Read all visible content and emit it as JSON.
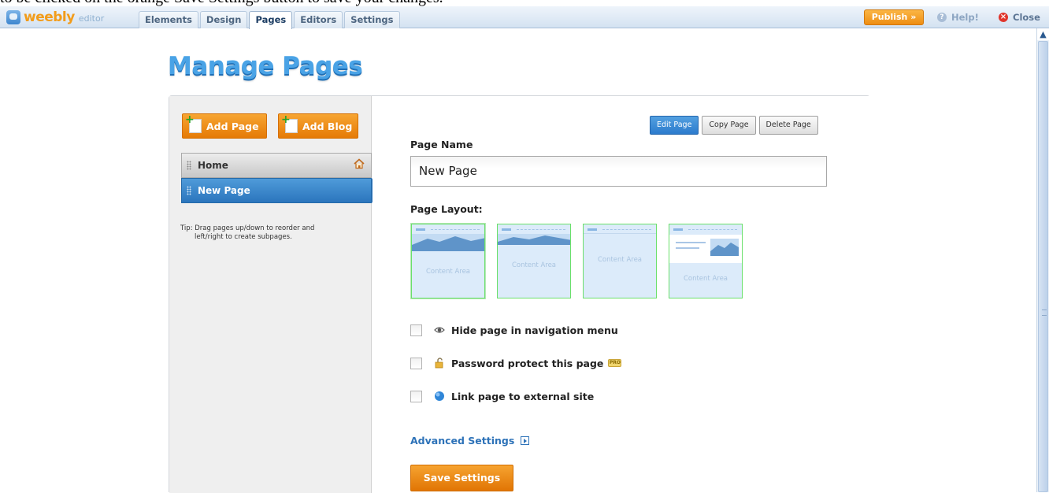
{
  "caption": "to be clicked on the orange Save Settings button to save your changes.",
  "app": {
    "logo": "weebly",
    "logo_sub": "editor"
  },
  "tabs": [
    {
      "label": "Elements",
      "active": false
    },
    {
      "label": "Design",
      "active": false
    },
    {
      "label": "Pages",
      "active": true
    },
    {
      "label": "Editors",
      "active": false
    },
    {
      "label": "Settings",
      "active": false
    }
  ],
  "toolbar": {
    "publish_label": "Publish »",
    "help_label": "Help!",
    "close_label": "Close"
  },
  "heading": "Manage Pages",
  "sidebar": {
    "add_page_label": "Add Page",
    "add_blog_label": "Add Blog",
    "pages": [
      {
        "label": "Home",
        "selected": false,
        "icon": "home-icon"
      },
      {
        "label": "New Page",
        "selected": true
      }
    ],
    "tip_line1": "Tip: Drag pages up/down to reorder and",
    "tip_line2": "left/right to create subpages."
  },
  "editor": {
    "actions": [
      {
        "label": "Edit Page",
        "active": true
      },
      {
        "label": "Copy Page",
        "active": false
      },
      {
        "label": "Delete Page",
        "active": false
      }
    ],
    "page_name_label": "Page Name",
    "page_name_value": "New Page",
    "page_layout_label": "Page Layout:",
    "layouts": [
      {
        "caption": "Content Area",
        "selected": true
      },
      {
        "caption": "Content Area",
        "selected": false
      },
      {
        "caption": "Content Area",
        "selected": false
      },
      {
        "caption": "Content Area",
        "selected": false
      }
    ],
    "options": [
      {
        "label": "Hide page in navigation menu",
        "icon": "eye-icon",
        "checked": false
      },
      {
        "label": "Password protect this page",
        "icon": "lock-icon",
        "checked": false,
        "badge": "PRO"
      },
      {
        "label": "Link page to external site",
        "icon": "globe-icon",
        "checked": false
      }
    ],
    "advanced_label": "Advanced Settings",
    "save_label": "Save Settings"
  },
  "colors": {
    "accent_orange": "#e57a06",
    "accent_blue": "#2b75bd",
    "heading_blue": "#4aa3e6"
  }
}
